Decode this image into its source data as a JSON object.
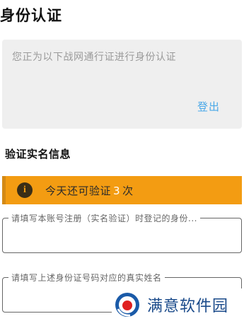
{
  "page": {
    "title": "身份认证"
  },
  "account": {
    "notice": "您正为以下战网通行证进行身份认证",
    "logout_label": "登出"
  },
  "verify": {
    "section_title": "验证实名信息",
    "notice_prefix": "今天还可验证",
    "notice_count": "3",
    "notice_suffix": "次",
    "id_field": {
      "legend": "请填写本账号注册（实名验证）时登记的身份...",
      "value": ""
    },
    "name_field": {
      "legend": "请填写上述身份证号码对应的真实姓名",
      "value": ""
    }
  },
  "colors": {
    "warning": "#f39c12",
    "link": "#4aa8e8",
    "card_bg": "#efefef"
  },
  "watermark": {
    "text": "满意软件园",
    "logo": "site-logo"
  }
}
